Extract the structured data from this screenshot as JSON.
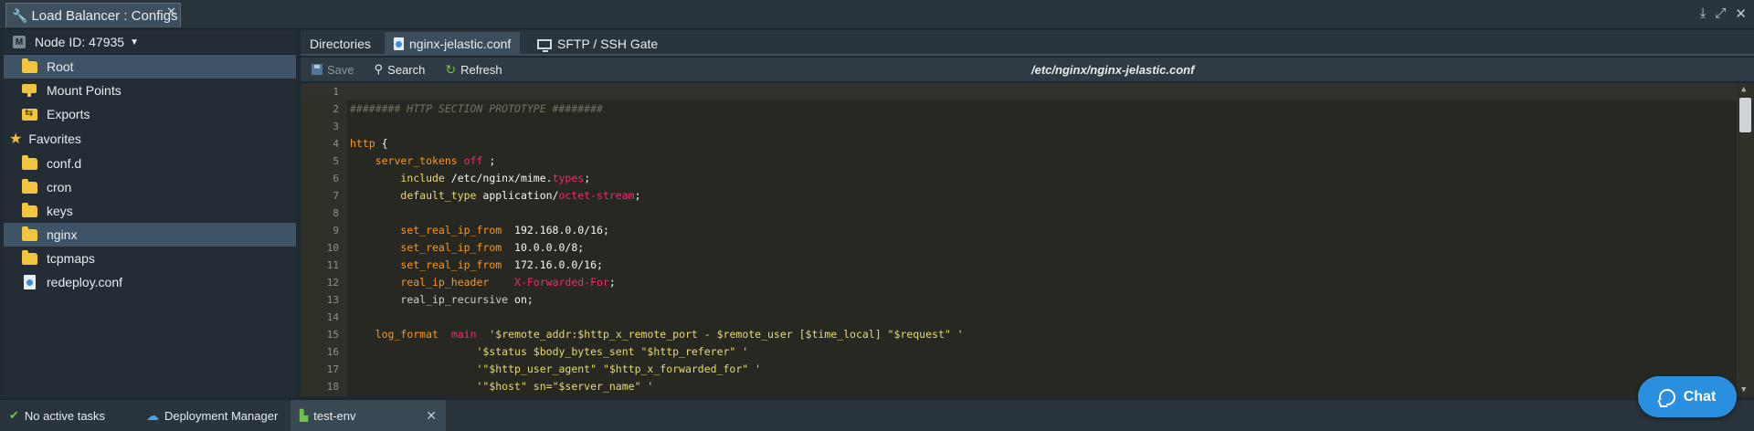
{
  "window": {
    "title": "Load Balancer : Configs",
    "close_glyph": "✕"
  },
  "sidebar": {
    "node_label": "Node ID: 47935",
    "node_badge": "M",
    "items": [
      {
        "label": "Root",
        "icon": "folder-icon",
        "selected": true
      },
      {
        "label": "Mount Points",
        "icon": "mount-points-icon"
      },
      {
        "label": "Exports",
        "icon": "exports-icon"
      }
    ],
    "favorites_label": "Favorites",
    "favorites": [
      {
        "label": "conf.d",
        "icon": "folder-icon"
      },
      {
        "label": "cron",
        "icon": "folder-icon"
      },
      {
        "label": "keys",
        "icon": "folder-icon"
      },
      {
        "label": "nginx",
        "icon": "folder-icon",
        "selected": true
      },
      {
        "label": "tcpmaps",
        "icon": "folder-icon"
      },
      {
        "label": "redeploy.conf",
        "icon": "file-icon"
      }
    ]
  },
  "tabs": {
    "directories": "Directories",
    "file": "nginx-jelastic.conf",
    "sftp": "SFTP / SSH Gate"
  },
  "toolbar": {
    "save": "Save",
    "search": "Search",
    "refresh": "Refresh",
    "path": "/etc/nginx/nginx-jelastic.conf"
  },
  "editor": {
    "lines": [
      {
        "n": "1",
        "tokens": []
      },
      {
        "n": "2",
        "tokens": [
          [
            "t-comment",
            "######## HTTP SECTION PROTOTYPE ########"
          ]
        ]
      },
      {
        "n": "3",
        "tokens": []
      },
      {
        "n": "4",
        "tokens": [
          [
            "t-orange",
            "http"
          ],
          [
            "t-plain",
            " {"
          ]
        ]
      },
      {
        "n": "5",
        "tokens": [
          [
            "t-plain",
            "    "
          ],
          [
            "t-orange",
            "server_tokens"
          ],
          [
            "t-plain",
            " "
          ],
          [
            "t-red",
            "off"
          ],
          [
            "t-plain",
            " ;"
          ]
        ]
      },
      {
        "n": "6",
        "tokens": [
          [
            "t-plain",
            "        "
          ],
          [
            "t-directive",
            "include"
          ],
          [
            "t-plain",
            " /etc/nginx/mime."
          ],
          [
            "t-red",
            "types"
          ],
          [
            "t-plain",
            ";"
          ]
        ]
      },
      {
        "n": "7",
        "tokens": [
          [
            "t-plain",
            "        "
          ],
          [
            "t-directive",
            "default_type"
          ],
          [
            "t-plain",
            " application/"
          ],
          [
            "t-red",
            "octet-stream"
          ],
          [
            "t-plain",
            ";"
          ]
        ]
      },
      {
        "n": "8",
        "tokens": []
      },
      {
        "n": "9",
        "tokens": [
          [
            "t-plain",
            "        "
          ],
          [
            "t-orange",
            "set_real_ip_from"
          ],
          [
            "t-plain",
            "  192.168.0.0/16;"
          ]
        ]
      },
      {
        "n": "10",
        "tokens": [
          [
            "t-plain",
            "        "
          ],
          [
            "t-orange",
            "set_real_ip_from"
          ],
          [
            "t-plain",
            "  10.0.0.0/8;"
          ]
        ]
      },
      {
        "n": "11",
        "tokens": [
          [
            "t-plain",
            "        "
          ],
          [
            "t-orange",
            "set_real_ip_from"
          ],
          [
            "t-plain",
            "  172.16.0.0/16;"
          ]
        ]
      },
      {
        "n": "12",
        "tokens": [
          [
            "t-plain",
            "        "
          ],
          [
            "t-orange",
            "real_ip_header"
          ],
          [
            "t-plain",
            "    "
          ],
          [
            "t-red",
            "X-Forwarded-For"
          ],
          [
            "t-plain",
            ";"
          ]
        ]
      },
      {
        "n": "13",
        "tokens": [
          [
            "t-plain",
            "        "
          ],
          [
            "t-gray",
            "real_ip_recursive"
          ],
          [
            "t-plain",
            " on;"
          ]
        ]
      },
      {
        "n": "14",
        "tokens": []
      },
      {
        "n": "15",
        "tokens": [
          [
            "t-plain",
            "    "
          ],
          [
            "t-orange",
            "log_format"
          ],
          [
            "t-plain",
            "  "
          ],
          [
            "t-red",
            "main"
          ],
          [
            "t-plain",
            "  "
          ],
          [
            "t-string",
            "'$remote_addr:$http_x_remote_port - $remote_user [$time_local] \"$request\" '"
          ]
        ]
      },
      {
        "n": "16",
        "tokens": [
          [
            "t-plain",
            "                    "
          ],
          [
            "t-string",
            "'$status $body_bytes_sent \"$http_referer\" '"
          ]
        ]
      },
      {
        "n": "17",
        "tokens": [
          [
            "t-plain",
            "                    "
          ],
          [
            "t-string",
            "'\"$http_user_agent\" \"$http_x_forwarded_for\" '"
          ]
        ]
      },
      {
        "n": "18",
        "tokens": [
          [
            "t-plain",
            "                    "
          ],
          [
            "t-string",
            "'\"$host\" sn=\"$server_name\" '"
          ]
        ]
      }
    ]
  },
  "taskbar": {
    "tasks": "No active tasks",
    "deployment_manager": "Deployment Manager",
    "env": "test-env"
  },
  "chat": {
    "label": "Chat"
  }
}
